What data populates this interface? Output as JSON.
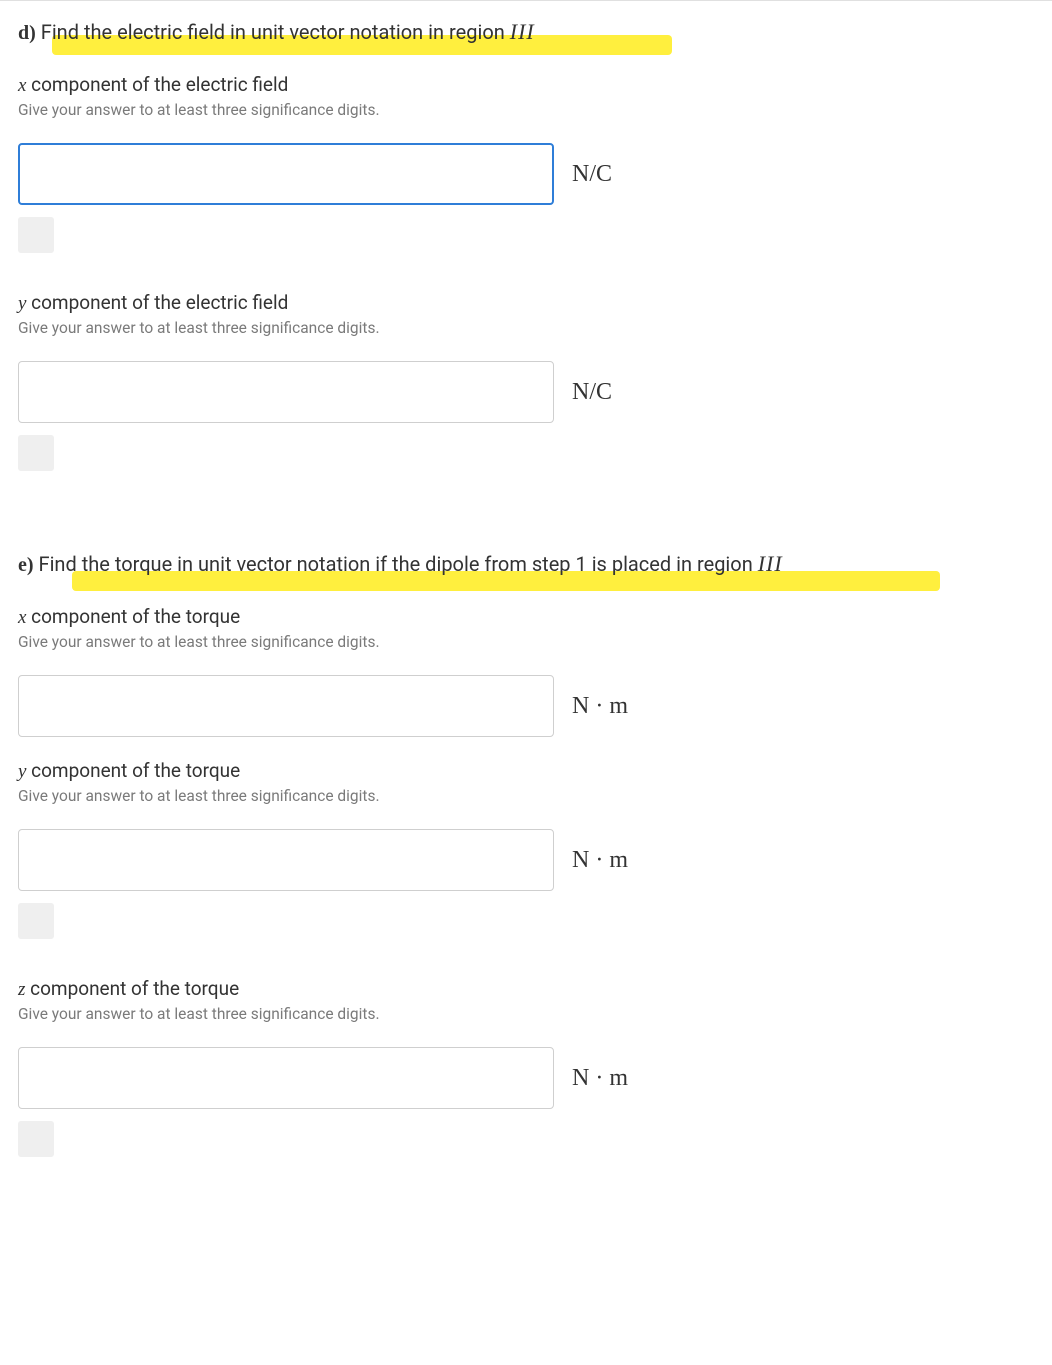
{
  "partD": {
    "label": "d)",
    "prompt_prefix": "Find the electric field in unit vector notation in region ",
    "region": "III",
    "sub": {
      "x": {
        "title_var": "x",
        "title_rest": " component of the electric field",
        "hint": "Give your answer to at least three significance digits.",
        "unit": "N/C",
        "value": ""
      },
      "y": {
        "title_var": "y",
        "title_rest": " component of the electric field",
        "hint": "Give your answer to at least three significance digits.",
        "unit": "N/C",
        "value": ""
      }
    }
  },
  "partE": {
    "label": "e)",
    "prompt_prefix": "Find the torque in unit vector notation if the dipole from step 1 is placed in region ",
    "region": "III",
    "sub": {
      "x": {
        "title_var": "x",
        "title_rest": " component of the torque",
        "hint": "Give your answer to at least three significance digits.",
        "unit": "N · m",
        "value": ""
      },
      "y": {
        "title_var": "y",
        "title_rest": " component of the torque",
        "hint": "Give your answer to at least three significance digits.",
        "unit": "N · m",
        "value": ""
      },
      "z": {
        "title_var": "z",
        "title_rest": " component of the torque",
        "hint": "Give your answer to at least three significance digits.",
        "unit": "N · m",
        "value": ""
      }
    }
  }
}
